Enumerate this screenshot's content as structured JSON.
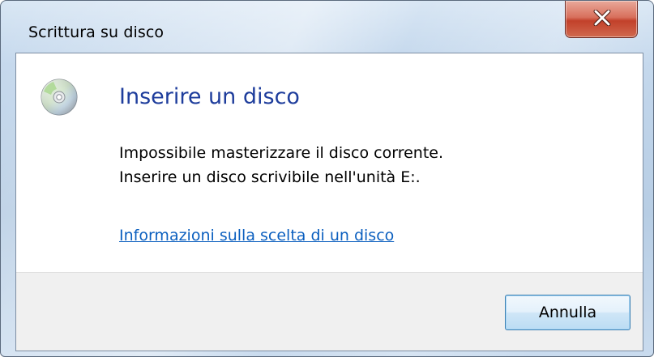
{
  "window": {
    "title": "Scrittura su disco"
  },
  "dialog": {
    "main_instruction": "Inserire un disco",
    "content_line1": "Impossibile masterizzare il disco corrente.",
    "content_line2": "Inserire un disco scrivibile nell'unità E:.",
    "help_link": "Informazioni sulla scelta di un disco",
    "icon": "cd-disc-icon"
  },
  "footer": {
    "cancel_label": "Annulla"
  },
  "colors": {
    "main_instruction": "#1e3d9c",
    "link": "#0b5fbf",
    "close_button": "#c2402a",
    "footer_background": "#f0f0f0"
  }
}
